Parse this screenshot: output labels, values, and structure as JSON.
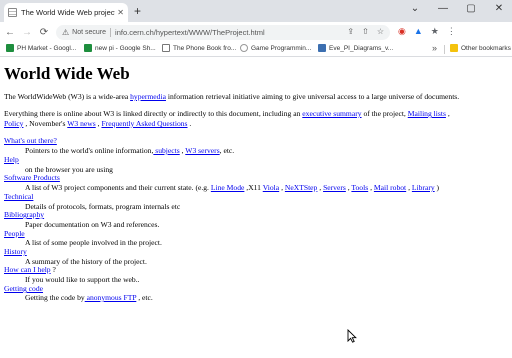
{
  "browser": {
    "tab": {
      "title": "The World Wide Web project",
      "close_glyph": "✕"
    },
    "new_tab_glyph": "+",
    "window_controls": [
      "⌄",
      "—",
      "▢",
      "✕"
    ],
    "nav": {
      "back": "←",
      "forward": "→",
      "reload": "⟳"
    },
    "omnibox": {
      "warning_glyph": "⚠",
      "secure_label": "Not secure",
      "url": "info.cern.ch/hypertext/WWW/TheProject.html",
      "icons": [
        "⇪",
        "⇧",
        "☆"
      ]
    },
    "extensions": [
      "◉",
      "▲",
      "★",
      "⋮"
    ],
    "bookmarks": [
      {
        "label": "PH Market - Googl...",
        "color": "#1e8e3e"
      },
      {
        "label": "new pi - Google Sh...",
        "color": "#1e8e3e"
      },
      {
        "label": "The Phone Book fro...",
        "color": "#555555"
      },
      {
        "label": "Game Programmin...",
        "color": "#888888"
      },
      {
        "label": "Eve_PI_Diagrams_v...",
        "color": "#3c6fb0"
      }
    ],
    "bookmarks_more": "»",
    "other_bookmarks": "Other bookmarks"
  },
  "page": {
    "title": "World Wide Web",
    "intro": {
      "pre": "The WorldWideWeb (W3) is a wide-area ",
      "link": "hypermedia",
      "post": " information retrieval initiative aiming to give universal access to a large universe of documents."
    },
    "summary": {
      "l1_pre": "Everything there is online about W3 is linked directly or indirectly to this document, including an ",
      "exec_summary": "executive summary",
      "l1_mid": " of the project, ",
      "mailing_lists": "Mailing lists",
      "l1_post": " ,",
      "policy": "Policy",
      "l2_mid1": " , November's ",
      "w3_news": "W3 news",
      "l2_mid2": " , ",
      "faq": "Frequently Asked Questions",
      "l2_post": " ."
    },
    "sections": {
      "whats_out": {
        "title": "What's out there?",
        "desc_pre": "Pointers to the world's online information,",
        "subjects": " subjects",
        "sep": " , ",
        "servers": "W3 servers",
        "desc_post": ", etc."
      },
      "help": {
        "title": "Help",
        "desc": "on the browser you are using"
      },
      "software": {
        "title": "Software Products",
        "desc_pre": "A list of W3 project components and their current state. (e.g. ",
        "line_mode": "Line Mode",
        "x11": " ,X11 ",
        "viola": "Viola",
        "nextstep": "NeXTStep",
        "servers": "Servers",
        "tools": "Tools",
        "mail_robot": " Mail robot",
        "library": "Library",
        "sep": " , ",
        "desc_post": " )"
      },
      "technical": {
        "title": "Technical",
        "desc": "Details of protocols, formats, program internals etc"
      },
      "bibliography": {
        "title": "Bibliography",
        "desc": "Paper documentation on W3 and references."
      },
      "people": {
        "title": "People",
        "desc": "A list of some people involved in the project."
      },
      "history": {
        "title": "History",
        "desc": "A summary of the history of the project."
      },
      "how_help": {
        "title": "How can I help",
        "title_post": " ?",
        "desc": "If you would like to support the web.."
      },
      "getting_code": {
        "title": "Getting code",
        "desc_pre": "Getting the code by",
        "ftp": " anonymous FTP",
        "desc_post": " , etc."
      }
    }
  }
}
